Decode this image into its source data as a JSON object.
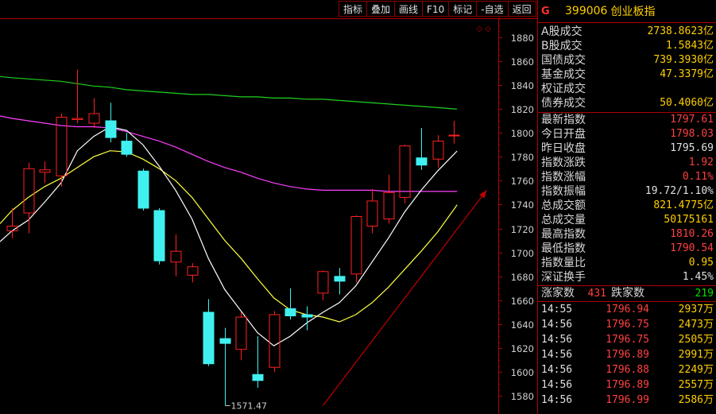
{
  "toolbar": {
    "buttons": [
      "指标",
      "叠加",
      "画线",
      "F10",
      "标记",
      "-自选",
      "返回"
    ]
  },
  "diamond_marker": "◇ ◇",
  "panel": {
    "header": {
      "badge": "G",
      "code": "399006",
      "name": "创业板指"
    },
    "turnover": [
      {
        "label": "A股成交",
        "value": "2738.8623亿"
      },
      {
        "label": "B股成交",
        "value": "1.5843亿"
      },
      {
        "label": "国债成交",
        "value": "739.3930亿"
      },
      {
        "label": "基金成交",
        "value": "47.3379亿"
      },
      {
        "label": "权证成交",
        "value": ""
      },
      {
        "label": "债券成交",
        "value": "50.4060亿"
      }
    ],
    "index_stats": [
      {
        "label": "最新指数",
        "value": "1797.61",
        "color": "#ff4040"
      },
      {
        "label": "今日开盘",
        "value": "1798.03",
        "color": "#ff4040"
      },
      {
        "label": "昨日收盘",
        "value": "1795.69",
        "color": "#e0e0e0"
      },
      {
        "label": "指数涨跌",
        "value": "1.92",
        "color": "#ff4040"
      },
      {
        "label": "指数涨幅",
        "value": "0.11%",
        "color": "#ff4040"
      },
      {
        "label": "指数振幅",
        "value": "19.72/1.10%",
        "color": "#e0e0e0"
      },
      {
        "label": "总成交额",
        "value": "821.4775亿",
        "color": "#ffd000"
      },
      {
        "label": "总成交量",
        "value": "50175161",
        "color": "#ffd000"
      },
      {
        "label": "最高指数",
        "value": "1810.26",
        "color": "#ff4040"
      },
      {
        "label": "最低指数",
        "value": "1790.54",
        "color": "#ff4040"
      },
      {
        "label": "指数量比",
        "value": "0.95",
        "color": "#ffd000"
      },
      {
        "label": "深证换手",
        "value": "1.45%",
        "color": "#e0e0e0"
      }
    ],
    "updown": {
      "up_label": "涨家数",
      "up_value": "431",
      "down_label": "跌家数",
      "down_value": "219"
    },
    "ticks": [
      {
        "time": "14:55",
        "price": "1796.94",
        "vol": "2937",
        "unit": "万"
      },
      {
        "time": "14:56",
        "price": "1796.75",
        "vol": "2473",
        "unit": "万"
      },
      {
        "time": "14:56",
        "price": "1796.75",
        "vol": "2505",
        "unit": "万"
      },
      {
        "time": "14:56",
        "price": "1796.89",
        "vol": "2991",
        "unit": "万"
      },
      {
        "time": "14:56",
        "price": "1796.88",
        "vol": "2249",
        "unit": "万"
      },
      {
        "time": "14:56",
        "price": "1796.89",
        "vol": "2557",
        "unit": "万"
      },
      {
        "time": "14:56",
        "price": "1796.99",
        "vol": "2586",
        "unit": "万"
      }
    ]
  },
  "chart_data": {
    "type": "candlestick",
    "ylim": [
      1565,
      1895
    ],
    "y_ticks": [
      1580,
      1600,
      1620,
      1640,
      1660,
      1680,
      1700,
      1720,
      1740,
      1760,
      1780,
      1800,
      1820,
      1840,
      1860,
      1880
    ],
    "low_annotation": "1571.47",
    "colors": {
      "up": "#ff2020",
      "down": "#40f0f0",
      "ma_short": "#ffffff",
      "ma_mid": "#ffff40",
      "ma_long": "#ff40ff",
      "ma_longest": "#20d020",
      "arrow": "#c00000"
    },
    "candles": [
      {
        "o": 1718,
        "h": 1737,
        "l": 1712,
        "c": 1722
      },
      {
        "o": 1733,
        "h": 1775,
        "l": 1716,
        "c": 1770
      },
      {
        "o": 1767,
        "h": 1776,
        "l": 1758,
        "c": 1769
      },
      {
        "o": 1764,
        "h": 1816,
        "l": 1755,
        "c": 1813
      },
      {
        "o": 1811,
        "h": 1853,
        "l": 1808,
        "c": 1812
      },
      {
        "o": 1808,
        "h": 1829,
        "l": 1804,
        "c": 1816
      },
      {
        "o": 1810,
        "h": 1825,
        "l": 1792,
        "c": 1796
      },
      {
        "o": 1793,
        "h": 1800,
        "l": 1780,
        "c": 1782
      },
      {
        "o": 1768,
        "h": 1770,
        "l": 1735,
        "c": 1737
      },
      {
        "o": 1735,
        "h": 1737,
        "l": 1690,
        "c": 1693
      },
      {
        "o": 1692,
        "h": 1715,
        "l": 1680,
        "c": 1701
      },
      {
        "o": 1681,
        "h": 1691,
        "l": 1675,
        "c": 1688
      },
      {
        "o": 1650,
        "h": 1661,
        "l": 1605,
        "c": 1607
      },
      {
        "o": 1628,
        "h": 1637,
        "l": 1572,
        "c": 1624
      },
      {
        "o": 1619,
        "h": 1650,
        "l": 1610,
        "c": 1646
      },
      {
        "o": 1598,
        "h": 1630,
        "l": 1587,
        "c": 1593
      },
      {
        "o": 1604,
        "h": 1651,
        "l": 1600,
        "c": 1648
      },
      {
        "o": 1653,
        "h": 1670,
        "l": 1644,
        "c": 1647
      },
      {
        "o": 1648,
        "h": 1655,
        "l": 1635,
        "c": 1646
      },
      {
        "o": 1666,
        "h": 1685,
        "l": 1660,
        "c": 1684
      },
      {
        "o": 1680,
        "h": 1687,
        "l": 1665,
        "c": 1676
      },
      {
        "o": 1682,
        "h": 1731,
        "l": 1675,
        "c": 1730
      },
      {
        "o": 1722,
        "h": 1753,
        "l": 1716,
        "c": 1743
      },
      {
        "o": 1728,
        "h": 1765,
        "l": 1724,
        "c": 1750
      },
      {
        "o": 1746,
        "h": 1790,
        "l": 1741,
        "c": 1789
      },
      {
        "o": 1779,
        "h": 1804,
        "l": 1769,
        "c": 1773
      },
      {
        "o": 1778,
        "h": 1798,
        "l": 1771,
        "c": 1793
      },
      {
        "o": 1798,
        "h": 1810,
        "l": 1791,
        "c": 1798
      }
    ],
    "ma_short": [
      1718,
      1727,
      1742,
      1758,
      1785,
      1797,
      1805,
      1802,
      1790,
      1772,
      1752,
      1728,
      1695,
      1669,
      1651,
      1633,
      1622,
      1630,
      1641,
      1650,
      1658,
      1672,
      1692,
      1712,
      1734,
      1752,
      1768,
      1782
    ],
    "ma_mid": [
      1735,
      1746,
      1755,
      1762,
      1771,
      1780,
      1785,
      1784,
      1778,
      1770,
      1760,
      1746,
      1728,
      1710,
      1695,
      1678,
      1662,
      1652,
      1648,
      1646,
      1642,
      1648,
      1658,
      1671,
      1686,
      1701,
      1717,
      1736
    ],
    "ma_long": [
      1812,
      1810,
      1808,
      1806,
      1805,
      1805,
      1804,
      1801,
      1797,
      1793,
      1788,
      1782,
      1776,
      1771,
      1767,
      1762,
      1758,
      1755,
      1753,
      1752,
      1752,
      1752,
      1752,
      1751,
      1751,
      1751,
      1751,
      1751
    ],
    "ma_longest": [
      1846,
      1845,
      1844,
      1843,
      1841,
      1839,
      1838,
      1836,
      1835,
      1834,
      1833,
      1832,
      1832,
      1831,
      1830,
      1830,
      1829,
      1829,
      1828,
      1828,
      1827,
      1826,
      1825,
      1824,
      1823,
      1822,
      1821,
      1820
    ]
  }
}
